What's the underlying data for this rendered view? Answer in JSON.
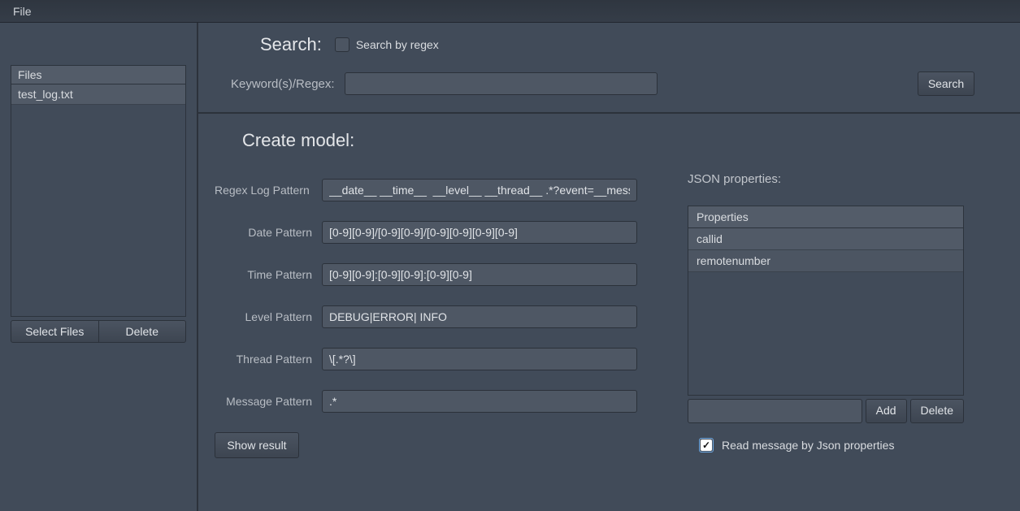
{
  "menubar": {
    "file": "File"
  },
  "sidebar": {
    "files_header": "Files",
    "files": [
      {
        "name": "test_log.txt"
      }
    ],
    "select_files_btn": "Select Files",
    "delete_btn": "Delete"
  },
  "search": {
    "title": "Search:",
    "regex_checkbox_label": "Search by regex",
    "regex_checked": false,
    "keyword_label": "Keyword(s)/Regex:",
    "keyword_value": "",
    "search_btn": "Search"
  },
  "model": {
    "title": "Create model:",
    "patterns": {
      "regex_log": {
        "label": "Regex Log Pattern",
        "value": "__date__ __time__  __level__ __thread__ .*?event=__messa"
      },
      "date": {
        "label": "Date Pattern",
        "value": "[0-9][0-9]/[0-9][0-9]/[0-9][0-9][0-9][0-9]"
      },
      "time": {
        "label": "Time Pattern",
        "value": "[0-9][0-9]:[0-9][0-9]:[0-9][0-9]"
      },
      "level": {
        "label": "Level Pattern",
        "value": "DEBUG|ERROR| INFO"
      },
      "thread": {
        "label": "Thread Pattern",
        "value": "\\[.*?\\]"
      },
      "message": {
        "label": "Message Pattern",
        "value": ".*"
      }
    },
    "show_result_btn": "Show result"
  },
  "json": {
    "title": "JSON properties:",
    "header": "Properties",
    "properties": [
      {
        "name": "callid"
      },
      {
        "name": "remotenumber"
      }
    ],
    "new_prop_value": "",
    "add_btn": "Add",
    "delete_btn": "Delete",
    "read_by_json_label": "Read message by Json properties",
    "read_by_json_checked": true
  }
}
